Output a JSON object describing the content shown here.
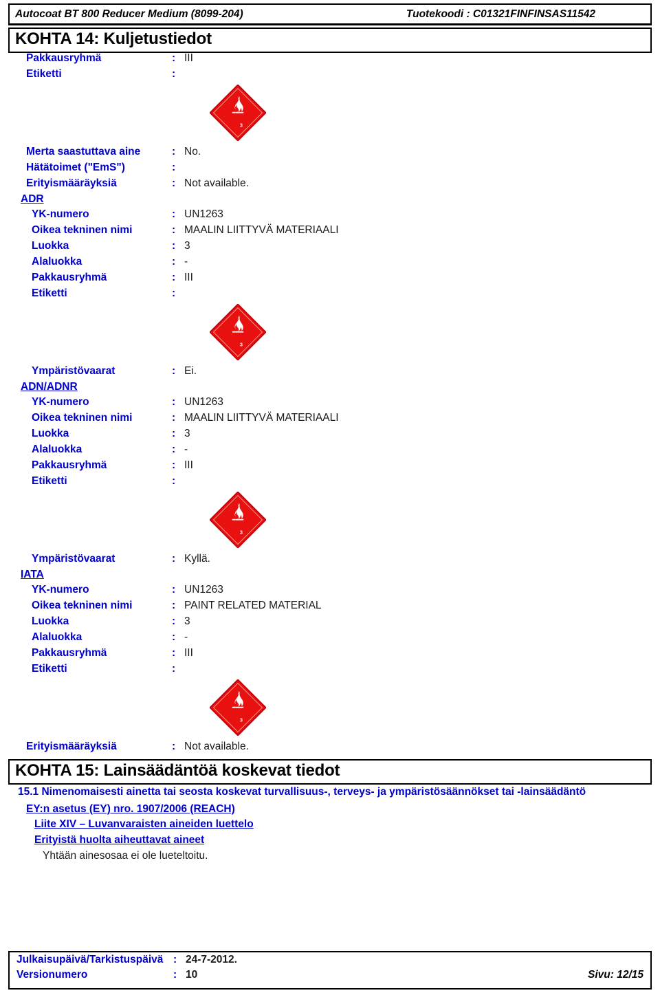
{
  "header": {
    "product_name": "Autocoat BT 800 Reducer Medium (8099-204)",
    "product_code_label": "Tuotekoodi :",
    "product_code": "C01321FINFINSAS11542",
    "product_code_full": "Tuotekoodi : C01321FINFINSAS11542"
  },
  "section14": {
    "title": "KOHTA 14: Kuljetustiedot",
    "top_rows": [
      {
        "label": "Pakkausryhmä",
        "sep": ":",
        "value": "III"
      },
      {
        "label": "Etiketti",
        "sep": ":",
        "value": ""
      }
    ],
    "general_rows": [
      {
        "label": "Merta saastuttava aine",
        "sep": ":",
        "value": "No."
      },
      {
        "label": "Hätätoimet (\"EmS\")",
        "sep": ":",
        "value": ""
      },
      {
        "label": "Erityismääräyksiä",
        "sep": ":",
        "value": "Not available."
      }
    ],
    "modes": [
      {
        "name": "ADR",
        "rows": [
          {
            "label": "YK-numero",
            "sep": ":",
            "value": "UN1263"
          },
          {
            "label": "Oikea tekninen nimi",
            "sep": ":",
            "value": "MAALIN LIITTYVÄ MATERIAALI"
          },
          {
            "label": "Luokka",
            "sep": ":",
            "value": "3"
          },
          {
            "label": "Alaluokka",
            "sep": ":",
            "value": "-"
          },
          {
            "label": "Pakkausryhmä",
            "sep": ":",
            "value": "III"
          },
          {
            "label": "Etiketti",
            "sep": ":",
            "value": ""
          }
        ],
        "trailing": {
          "label": "Ympäristövaarat",
          "sep": ":",
          "value": "Ei."
        }
      },
      {
        "name": "ADN/ADNR",
        "rows": [
          {
            "label": "YK-numero",
            "sep": ":",
            "value": "UN1263"
          },
          {
            "label": "Oikea tekninen nimi",
            "sep": ":",
            "value": "MAALIN LIITTYVÄ MATERIAALI"
          },
          {
            "label": "Luokka",
            "sep": ":",
            "value": "3"
          },
          {
            "label": "Alaluokka",
            "sep": ":",
            "value": "-"
          },
          {
            "label": "Pakkausryhmä",
            "sep": ":",
            "value": "III"
          },
          {
            "label": "Etiketti",
            "sep": ":",
            "value": ""
          }
        ],
        "trailing": {
          "label": "Ympäristövaarat",
          "sep": ":",
          "value": "Kyllä."
        }
      },
      {
        "name": "IATA",
        "rows": [
          {
            "label": "YK-numero",
            "sep": ":",
            "value": "UN1263"
          },
          {
            "label": "Oikea tekninen nimi",
            "sep": ":",
            "value": "PAINT RELATED MATERIAL"
          },
          {
            "label": "Luokka",
            "sep": ":",
            "value": "3"
          },
          {
            "label": "Alaluokka",
            "sep": ":",
            "value": "-"
          },
          {
            "label": "Pakkausryhmä",
            "sep": ":",
            "value": "III"
          },
          {
            "label": "Etiketti",
            "sep": ":",
            "value": ""
          }
        ],
        "trailing": {
          "label": "Erityismääräyksiä",
          "sep": ":",
          "value": "Not available."
        }
      }
    ],
    "hazard_label": {
      "icon": "flammable-liquid-diamond-icon",
      "class_number": "3",
      "fill_color": "#E8110F",
      "border_color": "#C1000A",
      "symbol_color": "#FFFFFF"
    }
  },
  "section15": {
    "title": "KOHTA 15: Lainsäädäntöä koskevat tiedot",
    "subtitle": "15.1 Nimenomaisesti ainetta tai seosta koskevat turvallisuus-, terveys- ja ympäristösäännökset tai -lainsäädäntö",
    "link_reach": "EY:n asetus (EY) nro. 1907/2006 (REACH)",
    "link_annex14": "Liite XIV – Luvanvaraisten aineiden luettelo",
    "link_svhc": "Erityistä huolta aiheuttavat aineet",
    "note": "Yhtään ainesosaa ei ole lueteltoitu."
  },
  "footer": {
    "date_label": "Julkaisupäivä/Tarkistuspäivä",
    "date_sep": ":",
    "date_value": "24-7-2012.",
    "version_label": "Versionumero",
    "version_sep": ":",
    "version_value": "10",
    "page_label": "Sivu: 12/15"
  }
}
